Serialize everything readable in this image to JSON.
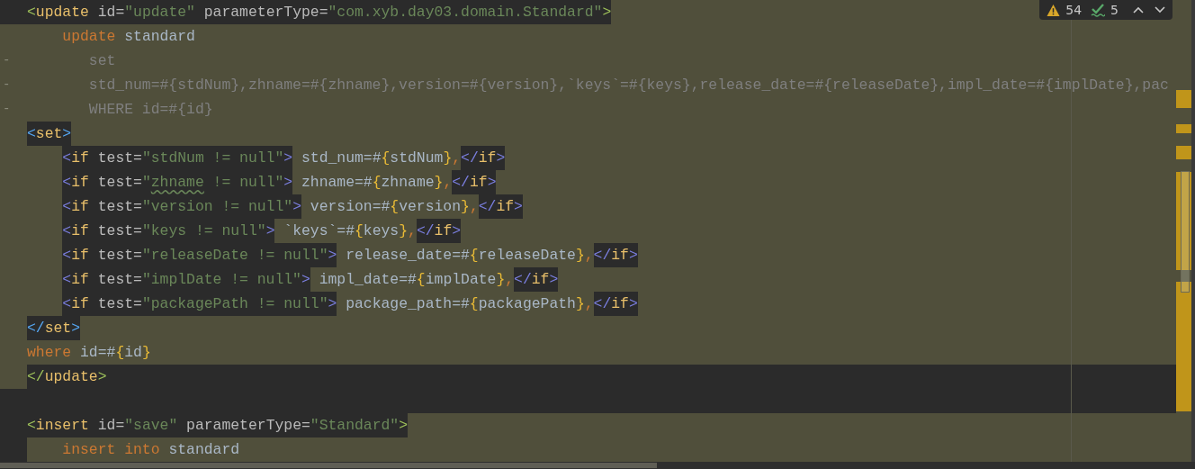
{
  "inspection_widget": {
    "warnings": "54",
    "weak_warnings": "5"
  },
  "lines": [
    {
      "changed": false,
      "dark": false,
      "deleted": false,
      "indented": false,
      "segments": [
        {
          "highlight": true,
          "tokens": [
            {
              "t": "<",
              "kind": "bracket",
              "color": "#9fc25a"
            },
            {
              "t": "update",
              "kind": "tag"
            },
            {
              "t": " id",
              "kind": "attr"
            },
            {
              "t": "=",
              "kind": "attr"
            },
            {
              "t": "\"update\"",
              "kind": "string"
            },
            {
              "t": " parameterType",
              "kind": "attr"
            },
            {
              "t": "=",
              "kind": "attr"
            },
            {
              "t": "\"com.xyb.day03.domain.Standard\"",
              "kind": "string"
            },
            {
              "t": ">",
              "kind": "bracket",
              "color": "#9fc25a"
            }
          ]
        }
      ]
    },
    {
      "changed": true,
      "dark": false,
      "deleted": false,
      "indented": true,
      "segments": [
        {
          "highlight": false,
          "tokens": [
            {
              "t": "update",
              "kind": "keyword"
            },
            {
              "t": " standard",
              "kind": "text"
            }
          ]
        }
      ]
    },
    {
      "changed": true,
      "dark": false,
      "deleted": true,
      "marker": "-",
      "indented": true,
      "segments": [
        {
          "highlight": false,
          "tokens": [
            {
              "t": "set",
              "kind": "text"
            }
          ]
        }
      ]
    },
    {
      "changed": true,
      "dark": false,
      "deleted": true,
      "marker": "-",
      "indented": true,
      "segments": [
        {
          "highlight": false,
          "tokens": [
            {
              "t": "std_num=#{stdNum},zhname=#{zhname},version=#{version},`keys`=#{keys},release_date=#{releaseDate},impl_date=#{implDate},pac",
              "kind": "text"
            }
          ]
        }
      ]
    },
    {
      "changed": true,
      "dark": false,
      "deleted": true,
      "marker": "-",
      "indented": true,
      "segments": [
        {
          "highlight": false,
          "tokens": [
            {
              "t": "WHERE id=#{id}",
              "kind": "text"
            }
          ]
        }
      ]
    },
    {
      "changed": true,
      "dark": false,
      "deleted": false,
      "indented": false,
      "segments": [
        {
          "highlight": true,
          "tokens": [
            {
              "t": "<",
              "kind": "bracket",
              "color": "#56a8f5"
            },
            {
              "t": "set",
              "kind": "tag"
            },
            {
              "t": ">",
              "kind": "bracket",
              "color": "#56a8f5"
            }
          ]
        }
      ]
    },
    {
      "changed": true,
      "dark": false,
      "deleted": false,
      "indented": true,
      "segments": [
        {
          "highlight": true,
          "tokens": [
            {
              "t": "<",
              "kind": "bracket",
              "color": "#7b7fe0"
            },
            {
              "t": "if",
              "kind": "tag"
            },
            {
              "t": " test",
              "kind": "attr"
            },
            {
              "t": "=",
              "kind": "attr"
            },
            {
              "t": "\"stdNum != null\"",
              "kind": "string"
            },
            {
              "t": ">",
              "kind": "bracket",
              "color": "#7b7fe0"
            }
          ]
        },
        {
          "highlight": false,
          "tokens": [
            {
              "t": " std_num=#",
              "kind": "text"
            },
            {
              "t": "{",
              "kind": "brace"
            },
            {
              "t": "stdNum",
              "kind": "text"
            },
            {
              "t": "}",
              "kind": "brace"
            },
            {
              "t": ",",
              "kind": "comma"
            }
          ]
        },
        {
          "highlight": true,
          "tokens": [
            {
              "t": "</",
              "kind": "bracket",
              "color": "#7b7fe0"
            },
            {
              "t": "if",
              "kind": "tag"
            },
            {
              "t": ">",
              "kind": "bracket",
              "color": "#7b7fe0"
            }
          ]
        }
      ]
    },
    {
      "changed": true,
      "dark": false,
      "deleted": false,
      "indented": true,
      "segments": [
        {
          "highlight": true,
          "tokens": [
            {
              "t": "<",
              "kind": "bracket",
              "color": "#7b7fe0"
            },
            {
              "t": "if",
              "kind": "tag"
            },
            {
              "t": " test",
              "kind": "attr"
            },
            {
              "t": "=",
              "kind": "attr"
            },
            {
              "t": "\"",
              "kind": "string"
            },
            {
              "t": "zhname",
              "kind": "string",
              "typo": true
            },
            {
              "t": " != null\"",
              "kind": "string"
            },
            {
              "t": ">",
              "kind": "bracket",
              "color": "#7b7fe0"
            }
          ]
        },
        {
          "highlight": false,
          "tokens": [
            {
              "t": " zhname=#",
              "kind": "text"
            },
            {
              "t": "{",
              "kind": "brace"
            },
            {
              "t": "zhname",
              "kind": "text"
            },
            {
              "t": "}",
              "kind": "brace"
            },
            {
              "t": ",",
              "kind": "comma"
            }
          ]
        },
        {
          "highlight": true,
          "tokens": [
            {
              "t": "</",
              "kind": "bracket",
              "color": "#7b7fe0"
            },
            {
              "t": "if",
              "kind": "tag"
            },
            {
              "t": ">",
              "kind": "bracket",
              "color": "#7b7fe0"
            }
          ]
        }
      ]
    },
    {
      "changed": true,
      "dark": false,
      "deleted": false,
      "indented": true,
      "segments": [
        {
          "highlight": true,
          "tokens": [
            {
              "t": "<",
              "kind": "bracket",
              "color": "#7b7fe0"
            },
            {
              "t": "if",
              "kind": "tag"
            },
            {
              "t": " test",
              "kind": "attr"
            },
            {
              "t": "=",
              "kind": "attr"
            },
            {
              "t": "\"version != null\"",
              "kind": "string"
            },
            {
              "t": ">",
              "kind": "bracket",
              "color": "#7b7fe0"
            }
          ]
        },
        {
          "highlight": false,
          "tokens": [
            {
              "t": " version=#",
              "kind": "text"
            },
            {
              "t": "{",
              "kind": "brace"
            },
            {
              "t": "version",
              "kind": "text"
            },
            {
              "t": "}",
              "kind": "brace"
            },
            {
              "t": ",",
              "kind": "comma"
            }
          ]
        },
        {
          "highlight": true,
          "tokens": [
            {
              "t": "</",
              "kind": "bracket",
              "color": "#7b7fe0"
            },
            {
              "t": "if",
              "kind": "tag"
            },
            {
              "t": ">",
              "kind": "bracket",
              "color": "#7b7fe0"
            }
          ]
        }
      ]
    },
    {
      "changed": true,
      "dark": false,
      "deleted": false,
      "indented": true,
      "segments": [
        {
          "highlight": true,
          "tokens": [
            {
              "t": "<",
              "kind": "bracket",
              "color": "#7b7fe0"
            },
            {
              "t": "if",
              "kind": "tag"
            },
            {
              "t": " test",
              "kind": "attr"
            },
            {
              "t": "=",
              "kind": "attr"
            },
            {
              "t": "\"keys != null\"",
              "kind": "string"
            },
            {
              "t": ">",
              "kind": "bracket",
              "color": "#7b7fe0"
            }
          ]
        },
        {
          "highlight": false,
          "tokens": [
            {
              "t": " `keys`=#",
              "kind": "text"
            },
            {
              "t": "{",
              "kind": "brace"
            },
            {
              "t": "keys",
              "kind": "text"
            },
            {
              "t": "}",
              "kind": "brace"
            },
            {
              "t": ",",
              "kind": "comma"
            }
          ]
        },
        {
          "highlight": true,
          "tokens": [
            {
              "t": "</",
              "kind": "bracket",
              "color": "#7b7fe0"
            },
            {
              "t": "if",
              "kind": "tag"
            },
            {
              "t": ">",
              "kind": "bracket",
              "color": "#7b7fe0"
            }
          ]
        }
      ]
    },
    {
      "changed": true,
      "dark": false,
      "deleted": false,
      "indented": true,
      "segments": [
        {
          "highlight": true,
          "tokens": [
            {
              "t": "<",
              "kind": "bracket",
              "color": "#7b7fe0"
            },
            {
              "t": "if",
              "kind": "tag"
            },
            {
              "t": " test",
              "kind": "attr"
            },
            {
              "t": "=",
              "kind": "attr"
            },
            {
              "t": "\"releaseDate != null\"",
              "kind": "string"
            },
            {
              "t": ">",
              "kind": "bracket",
              "color": "#7b7fe0"
            }
          ]
        },
        {
          "highlight": false,
          "tokens": [
            {
              "t": " release_date=#",
              "kind": "text"
            },
            {
              "t": "{",
              "kind": "brace"
            },
            {
              "t": "releaseDate",
              "kind": "text"
            },
            {
              "t": "}",
              "kind": "brace"
            },
            {
              "t": ",",
              "kind": "comma"
            }
          ]
        },
        {
          "highlight": true,
          "tokens": [
            {
              "t": "</",
              "kind": "bracket",
              "color": "#7b7fe0"
            },
            {
              "t": "if",
              "kind": "tag"
            },
            {
              "t": ">",
              "kind": "bracket",
              "color": "#7b7fe0"
            }
          ]
        }
      ]
    },
    {
      "changed": true,
      "dark": false,
      "deleted": false,
      "indented": true,
      "segments": [
        {
          "highlight": true,
          "tokens": [
            {
              "t": "<",
              "kind": "bracket",
              "color": "#7b7fe0"
            },
            {
              "t": "if",
              "kind": "tag"
            },
            {
              "t": " test",
              "kind": "attr"
            },
            {
              "t": "=",
              "kind": "attr"
            },
            {
              "t": "\"implDate != null\"",
              "kind": "string"
            },
            {
              "t": ">",
              "kind": "bracket",
              "color": "#7b7fe0"
            }
          ]
        },
        {
          "highlight": false,
          "tokens": [
            {
              "t": " impl_date=#",
              "kind": "text"
            },
            {
              "t": "{",
              "kind": "brace"
            },
            {
              "t": "implDate",
              "kind": "text"
            },
            {
              "t": "}",
              "kind": "brace"
            },
            {
              "t": ",",
              "kind": "comma"
            }
          ]
        },
        {
          "highlight": true,
          "tokens": [
            {
              "t": "</",
              "kind": "bracket",
              "color": "#7b7fe0"
            },
            {
              "t": "if",
              "kind": "tag"
            },
            {
              "t": ">",
              "kind": "bracket",
              "color": "#7b7fe0"
            }
          ]
        }
      ]
    },
    {
      "changed": true,
      "dark": false,
      "deleted": false,
      "indented": true,
      "segments": [
        {
          "highlight": true,
          "tokens": [
            {
              "t": "<",
              "kind": "bracket",
              "color": "#7b7fe0"
            },
            {
              "t": "if",
              "kind": "tag"
            },
            {
              "t": " test",
              "kind": "attr"
            },
            {
              "t": "=",
              "kind": "attr"
            },
            {
              "t": "\"packagePath != null\"",
              "kind": "string"
            },
            {
              "t": ">",
              "kind": "bracket",
              "color": "#7b7fe0"
            }
          ]
        },
        {
          "highlight": false,
          "tokens": [
            {
              "t": " package_path=#",
              "kind": "text"
            },
            {
              "t": "{",
              "kind": "brace"
            },
            {
              "t": "packagePath",
              "kind": "text"
            },
            {
              "t": "}",
              "kind": "brace"
            },
            {
              "t": ",",
              "kind": "comma"
            }
          ]
        },
        {
          "highlight": true,
          "tokens": [
            {
              "t": "</",
              "kind": "bracket",
              "color": "#7b7fe0"
            },
            {
              "t": "if",
              "kind": "tag"
            },
            {
              "t": ">",
              "kind": "bracket",
              "color": "#7b7fe0"
            }
          ]
        }
      ]
    },
    {
      "changed": true,
      "dark": false,
      "deleted": false,
      "indented": false,
      "segments": [
        {
          "highlight": true,
          "tokens": [
            {
              "t": "</",
              "kind": "bracket",
              "color": "#56a8f5"
            },
            {
              "t": "set",
              "kind": "tag"
            },
            {
              "t": ">",
              "kind": "bracket",
              "color": "#56a8f5"
            }
          ]
        }
      ]
    },
    {
      "changed": true,
      "dark": false,
      "deleted": false,
      "indented": false,
      "segments": [
        {
          "highlight": false,
          "tokens": [
            {
              "t": "where",
              "kind": "keyword"
            },
            {
              "t": " id=#",
              "kind": "text"
            },
            {
              "t": "{",
              "kind": "brace"
            },
            {
              "t": "id",
              "kind": "text"
            },
            {
              "t": "}",
              "kind": "brace"
            }
          ]
        }
      ]
    },
    {
      "changed": true,
      "dark": true,
      "deleted": false,
      "indented": false,
      "segments": [
        {
          "tokens": [
            {
              "t": "</",
              "kind": "bracket",
              "color": "#9fc25a"
            },
            {
              "t": "update",
              "kind": "tag"
            },
            {
              "t": ">",
              "kind": "bracket",
              "color": "#9fc25a"
            }
          ]
        }
      ]
    },
    {
      "changed": false,
      "dark": true
    },
    {
      "changed": false,
      "dark": false,
      "deleted": false,
      "indented": false,
      "segments": [
        {
          "highlight": true,
          "tokens": [
            {
              "t": "<",
              "kind": "bracket",
              "color": "#9fc25a"
            },
            {
              "t": "insert",
              "kind": "tag"
            },
            {
              "t": " id",
              "kind": "attr"
            },
            {
              "t": "=",
              "kind": "attr"
            },
            {
              "t": "\"save\"",
              "kind": "string"
            },
            {
              "t": " parameterType",
              "kind": "attr"
            },
            {
              "t": "=",
              "kind": "attr"
            },
            {
              "t": "\"Standard\"",
              "kind": "string"
            },
            {
              "t": ">",
              "kind": "bracket",
              "color": "#9fc25a"
            }
          ]
        }
      ]
    },
    {
      "changed": false,
      "dark": false,
      "deleted": false,
      "indented": true,
      "segments": [
        {
          "highlight": false,
          "tokens": [
            {
              "t": "insert into",
              "kind": "keyword"
            },
            {
              "t": " standard",
              "kind": "text"
            }
          ]
        }
      ]
    }
  ]
}
